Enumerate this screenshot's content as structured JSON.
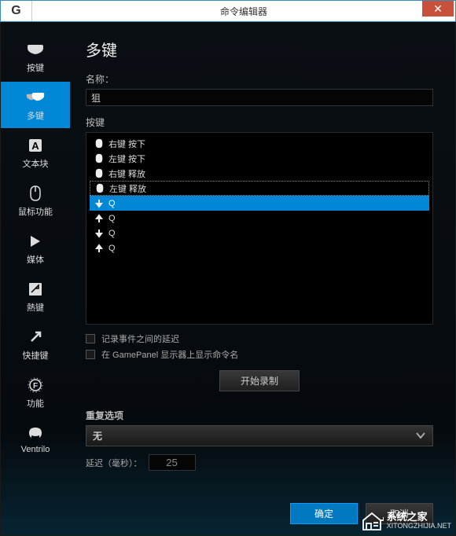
{
  "titlebar": {
    "logo": "G",
    "title": "命令编辑器"
  },
  "sidebar": {
    "items": [
      {
        "label": "按键"
      },
      {
        "label": "多键"
      },
      {
        "label": "文本块"
      },
      {
        "label": "鼠标功能"
      },
      {
        "label": "媒体"
      },
      {
        "label": "熱键"
      },
      {
        "label": "快捷键"
      },
      {
        "label": "功能"
      },
      {
        "label": "Ventrilo"
      }
    ]
  },
  "content": {
    "heading": "多键",
    "name_label": "名称：",
    "name_value": "狙",
    "keys_label": "按键",
    "key_events": [
      {
        "icon": "mouse",
        "text": "右键 按下"
      },
      {
        "icon": "mouse",
        "text": "左键 按下"
      },
      {
        "icon": "mouse",
        "text": "右键 释放"
      },
      {
        "icon": "mouse",
        "text": "左键 释放",
        "dotted": true
      },
      {
        "icon": "down",
        "text": "Q",
        "selected": true
      },
      {
        "icon": "up",
        "text": "Q"
      },
      {
        "icon": "down",
        "text": "Q"
      },
      {
        "icon": "up",
        "text": "Q"
      }
    ],
    "checkbox1": "记录事件之间的延迟",
    "checkbox2": "在 GamePanel 显示器上显示命令名",
    "record_btn": "开始录制",
    "repeat_label": "重复选项",
    "repeat_value": "无",
    "delay_label": "延迟（毫秒）：",
    "delay_value": "25"
  },
  "footer": {
    "ok": "确定",
    "cancel": "取消"
  },
  "watermark": {
    "line1": "系统之家",
    "line2": "XITONGZHIJIA.NET"
  }
}
